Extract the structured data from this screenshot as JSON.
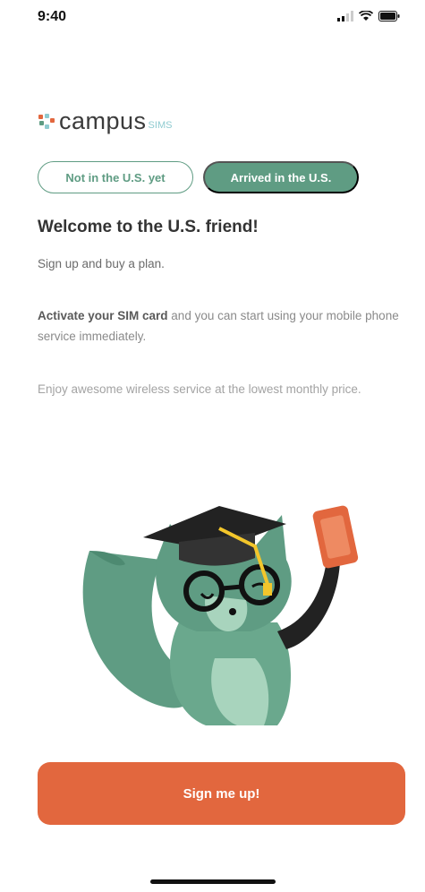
{
  "status_bar": {
    "time": "9:40"
  },
  "logo": {
    "text": "campus",
    "suffix": "SIMS"
  },
  "segments": {
    "left": "Not in the U.S. yet",
    "right": "Arrived in the U.S."
  },
  "content": {
    "title": "Welcome to the U.S. friend!",
    "p1": "Sign up and buy a plan.",
    "p2_bold": "Activate your SIM card",
    "p2_rest": " and you can start using your mobile phone service immediately.",
    "p3": "Enjoy awesome wireless service at the lowest monthly price."
  },
  "cta": {
    "label": "Sign me up!"
  },
  "colors": {
    "brand_green": "#5f9c83",
    "cta_orange": "#e2673e"
  }
}
